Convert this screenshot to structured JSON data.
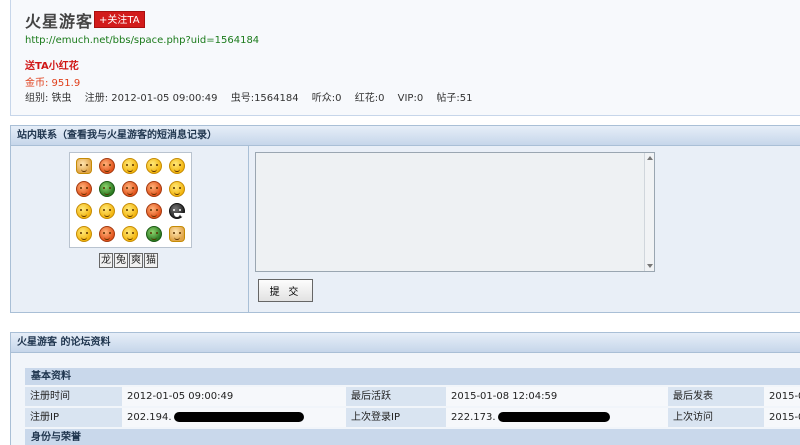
{
  "profile": {
    "name": "火星游客",
    "follow_label": "+关注TA",
    "url": "http://emuch.net/bbs/space.php?uid=1564184",
    "flower_link": "送TA小红花",
    "coins": "金币: 951.9",
    "stats": [
      "组别: 铁虫",
      "注册: 2012-01-05 09:00:49",
      "虫号:1564184",
      "听众:0",
      "红花:0",
      "VIP:0",
      "帖子:51"
    ]
  },
  "message": {
    "title": "站内联系（查看我与火星游客的短消息记录）",
    "emoji_sets": [
      "龙",
      "兔",
      "爽",
      "猫"
    ],
    "emojis": [
      {
        "name": "victory-hand-icon",
        "style": "hand"
      },
      {
        "name": "pig-face-icon",
        "style": "red"
      },
      {
        "name": "thinking-face-icon",
        "style": ""
      },
      {
        "name": "sad-face-icon",
        "style": ""
      },
      {
        "name": "grin-face-icon",
        "style": ""
      },
      {
        "name": "angry-face-icon",
        "style": "red"
      },
      {
        "name": "turtle-icon",
        "style": "green"
      },
      {
        "name": "heart-eyes-icon",
        "style": "red"
      },
      {
        "name": "pouting-face-icon",
        "style": "red"
      },
      {
        "name": "smile-face-icon",
        "style": ""
      },
      {
        "name": "dizzy-face-icon",
        "style": ""
      },
      {
        "name": "surprised-face-icon",
        "style": ""
      },
      {
        "name": "wink-face-icon",
        "style": ""
      },
      {
        "name": "crying-face-icon",
        "style": "red"
      },
      {
        "name": "owl-icon",
        "style": "owl"
      },
      {
        "name": "laugh-face-icon",
        "style": ""
      },
      {
        "name": "devil-face-icon",
        "style": "red"
      },
      {
        "name": "blush-face-icon",
        "style": ""
      },
      {
        "name": "person-icon",
        "style": "green"
      },
      {
        "name": "handshake-icon",
        "style": "hand"
      }
    ],
    "submit_label": "提 交"
  },
  "forum": {
    "title": "火星游客 的论坛资料",
    "basic_title": "基本资料",
    "row1": {
      "reg_time_label": "注册时间",
      "reg_time": "2012-01-05 09:00:49",
      "last_active_label": "最后活跃",
      "last_active": "2015-01-08 12:04:59",
      "last_post_label": "最后发表",
      "last_post": "2015-0"
    },
    "row2": {
      "reg_ip_label": "注册IP",
      "reg_ip": "202.194.",
      "last_login_ip_label": "上次登录IP",
      "last_login_ip": "222.173.",
      "last_visit_label": "上次访问",
      "last_visit": "2015-0"
    },
    "identity_title": "身份与荣誉"
  }
}
